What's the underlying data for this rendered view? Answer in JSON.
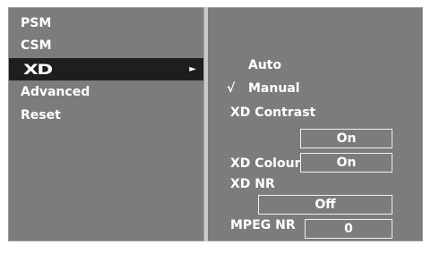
{
  "left_menu": {
    "items": [
      {
        "label": "PSM"
      },
      {
        "label": "CSM"
      },
      {
        "label": "XD",
        "arrow": "►"
      },
      {
        "label": "Advanced"
      },
      {
        "label": "Reset"
      }
    ]
  },
  "right_panel": {
    "auto_label": "Auto",
    "check_mark": "√",
    "manual_label": "Manual",
    "xd_contrast_label": "XD Contrast",
    "xd_contrast_value": "On",
    "xd_colour_label": "XD Colour",
    "xd_colour_value": "On",
    "xd_nr_label": "XD NR",
    "xd_nr_value": "Off",
    "mpeg_nr_label": "MPEG NR",
    "mpeg_nr_value": "0"
  },
  "colors": {
    "panel_bg": "#7c7c7c",
    "selected_bg": "#1e1e1e",
    "text": "#ffffff"
  }
}
